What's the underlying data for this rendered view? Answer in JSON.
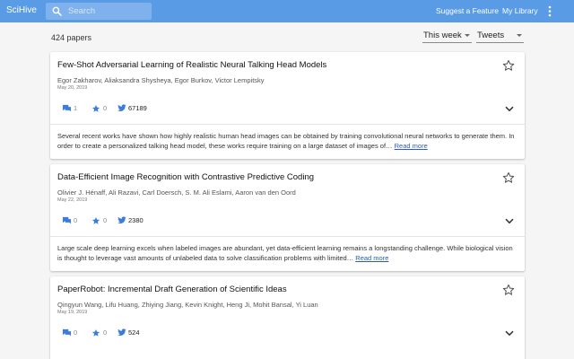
{
  "app": {
    "brand": "SciHive"
  },
  "search": {
    "placeholder": "Search"
  },
  "nav": {
    "suggest": "Suggest a Feature",
    "library": "My Library"
  },
  "colors": {
    "header": "#5a9be6",
    "accent": "#3b7dd8",
    "link": "#2a5db0"
  },
  "icons": {
    "search": "search-icon",
    "more": "more-vert-icon",
    "star": "star-outline-icon",
    "comment": "comment-icon",
    "tweet": "twitter-icon",
    "expand": "chevron-down-icon"
  },
  "list": {
    "count": "424 papers",
    "time_filter": "This week",
    "sort": "Tweets",
    "read_more": "Read more"
  },
  "papers": [
    {
      "title": "Few-Shot Adversarial Learning of Realistic Neural Talking Head Models",
      "authors": "Egor Zakharov, Aliaksandra Shysheya, Egor Burkov, Victor Lempitsky",
      "date": "May 20, 2019",
      "comments": "1",
      "stars": "0",
      "tweets": "67189",
      "abstract": "Several recent works have shown how highly realistic human head images can be obtained by training convolutional neural networks to generate them. In order to create a personalized talking head model, these works require training on a large dataset of images of…"
    },
    {
      "title": "Data-Efficient Image Recognition with Contrastive Predictive Coding",
      "authors": "Olivier J. Hénaff, Ali Razavi, Carl Doersch, S. M. Ali Eslami, Aaron van den Oord",
      "date": "May 22, 2019",
      "comments": "0",
      "stars": "0",
      "tweets": "2380",
      "abstract": "Large scale deep learning excels when labeled images are abundant, yet data-efficient learning remains a longstanding challenge. While biological vision is thought to leverage vast amounts of unlabeled data to solve classification problems with limited…"
    },
    {
      "title": "PaperRobot: Incremental Draft Generation of Scientific Ideas",
      "authors": "Qingyun Wang, Lifu Huang, Zhiying Jiang, Kevin Knight, Heng Ji, Mohit Bansal, Yi Luan",
      "date": "May 19, 2019",
      "comments": "0",
      "stars": "0",
      "tweets": "524",
      "abstract": ""
    }
  ]
}
